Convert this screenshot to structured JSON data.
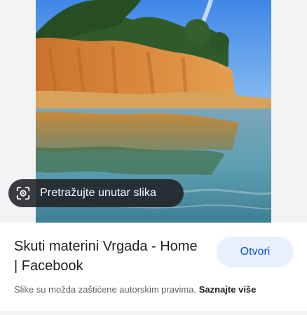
{
  "image_preview": {
    "alt": "Skuti materini Vrgada",
    "lens_search_label": "Pretražujte unutar slika",
    "lens_icon": "lens-camera-icon"
  },
  "result": {
    "title": "Skuti materini Vrgada - Home | Facebook",
    "open_label": "Otvori",
    "copyright_text": "Slike su možda zaštićene autorskim pravima.",
    "learn_more_label": "Saznajte više"
  },
  "colors": {
    "accent": "#0b57d0",
    "button_bg": "#e8f0fe",
    "chip_bg": "#202124",
    "panel_bg": "#f1f3f4"
  }
}
